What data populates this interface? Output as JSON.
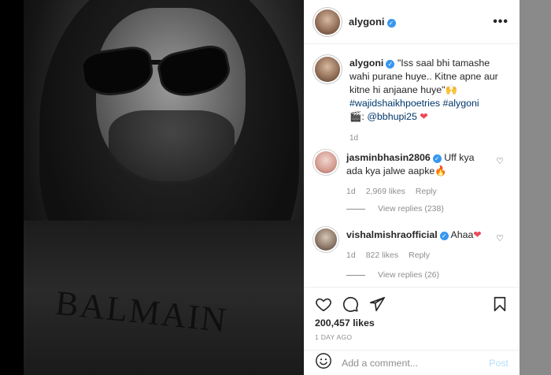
{
  "post": {
    "username": "alygoni",
    "verified_mark": "✓"
  },
  "caption": {
    "username": "alygoni",
    "quote": "\"Iss saal bhi tamashe wahi purane huye.. Kitne apne aur kitne hi anjaane huye\"",
    "quote_emoji": "🙌",
    "hashtags": "#wajidshaikhpoetries #alygoni",
    "credit_prefix": "🎬: ",
    "credit_mention": "@bbhupi25",
    "credit_emoji": "❤",
    "time": "1d"
  },
  "comments": [
    {
      "username": "jasminbhasin2806",
      "text": "Uff kya ada kya jalwe aapke",
      "emoji": "🔥",
      "time": "1d",
      "likes": "2,969 likes",
      "reply_label": "Reply",
      "view_replies": "View replies (238)"
    },
    {
      "username": "vishalmishraofficial",
      "text": "Ahaa",
      "emoji": "❤",
      "time": "1d",
      "likes": "822 likes",
      "reply_label": "Reply",
      "view_replies": "View replies (26)"
    }
  ],
  "actions": {
    "likes_count": "200,457 likes",
    "date": "1 DAY AGO"
  },
  "add_comment": {
    "placeholder": "Add a comment...",
    "post_label": "Post"
  },
  "photo": {
    "shirt_text": "BALMAIN"
  },
  "icons": {
    "more": "more-options-icon",
    "like": "heart-icon",
    "comment": "comment-icon",
    "share": "share-icon",
    "save": "bookmark-icon",
    "emoji": "emoji-icon",
    "comment_like": "heart-outline-icon"
  },
  "colors": {
    "link": "#00376b",
    "verified": "#3897f0",
    "muted": "#8e8e8e",
    "heart": "#ed4956",
    "post_disabled": "#b2dffc"
  }
}
